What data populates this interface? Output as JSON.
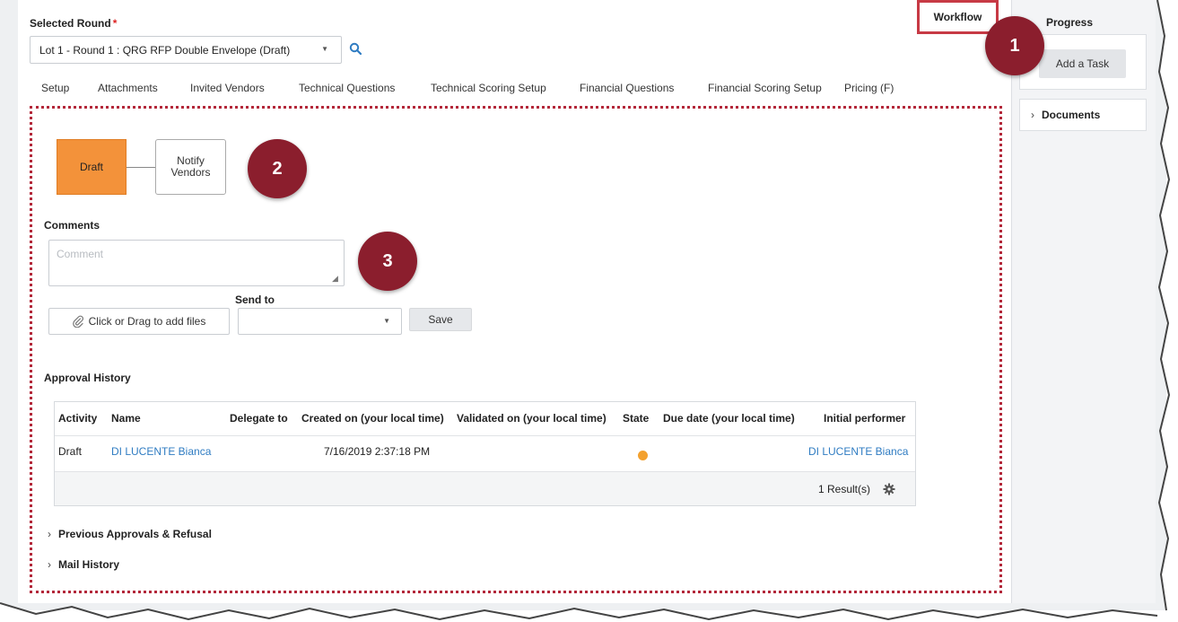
{
  "selected_round": {
    "label": "Selected Round",
    "required_mark": "*",
    "value": "Lot 1 - Round 1 : QRG RFP Double Envelope (Draft)"
  },
  "tabs": [
    {
      "label": "Setup"
    },
    {
      "label": "Attachments"
    },
    {
      "label": "Invited Vendors"
    },
    {
      "label": "Technical Questions"
    },
    {
      "label": "Technical Scoring Setup"
    },
    {
      "label": "Financial Questions"
    },
    {
      "label": "Financial Scoring Setup"
    },
    {
      "label": "Pricing (F)"
    },
    {
      "label": "Workflow",
      "active": true
    }
  ],
  "workflow": {
    "steps": [
      {
        "label": "Draft",
        "current": true
      },
      {
        "label_line1": "Notify",
        "label_line2": "Vendors"
      }
    ]
  },
  "comments": {
    "label": "Comments",
    "placeholder": "Comment",
    "attach_label": "Click or Drag to add files",
    "send_to_label": "Send to",
    "send_to_value": "",
    "save_label": "Save"
  },
  "approval_history": {
    "label": "Approval History",
    "columns": [
      "Activity",
      "Name",
      "Delegate to",
      "Created on (your local time)",
      "Validated on (your local time)",
      "State",
      "Due date (your local time)",
      "Initial performer"
    ],
    "rows": [
      {
        "activity": "Draft",
        "name": "DI LUCENTE Bianca",
        "delegate_to": "",
        "created_on": "7/16/2019 2:37:18 PM",
        "validated_on": "",
        "state_color": "#f3a12f",
        "due_date": "",
        "initial_performer": "DI LUCENTE Bianca"
      }
    ],
    "results": "1 Result(s)"
  },
  "sections": {
    "previous_approvals": "Previous Approvals & Refusal",
    "mail_history": "Mail History"
  },
  "sidebar": {
    "progress_title": "Progress",
    "add_task": "Add a Task",
    "documents": "Documents"
  },
  "callouts": {
    "one": "1",
    "two": "2",
    "three": "3"
  },
  "colors": {
    "accent_red": "#8b1e2d",
    "highlight_border": "#c73a45",
    "draft_orange": "#f3923a",
    "link_blue": "#2f7cc2"
  },
  "icons": {
    "search": "search-icon",
    "paperclip": "paperclip-icon",
    "gear": "gear-icon",
    "chevron": "chevron-right-icon"
  }
}
